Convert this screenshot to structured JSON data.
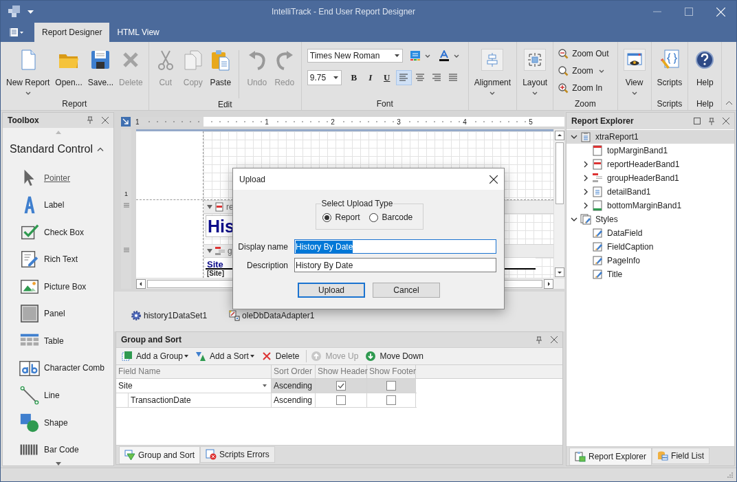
{
  "window": {
    "title": "IntelliTrack - End User Report Designer"
  },
  "ribbon_tabs": [
    {
      "label": "Report Designer",
      "selected": true
    },
    {
      "label": "HTML View",
      "selected": false
    }
  ],
  "ribbon_groups": [
    {
      "label": "Report",
      "kind": "large",
      "items": [
        {
          "label": "New Report",
          "kind": "new",
          "disabled": false,
          "dropdown": true
        },
        {
          "label": "Open...",
          "kind": "open",
          "disabled": false,
          "dropdown": false
        },
        {
          "label": "Save...",
          "kind": "save",
          "disabled": false,
          "dropdown": false
        },
        {
          "label": "Delete",
          "kind": "delete",
          "disabled": true,
          "dropdown": false
        }
      ]
    },
    {
      "label": "Edit",
      "kind": "large",
      "items": [
        {
          "label": "Cut",
          "kind": "cut",
          "disabled": true,
          "dropdown": false
        },
        {
          "label": "Copy",
          "kind": "copy",
          "disabled": true,
          "dropdown": false
        },
        {
          "label": "Paste",
          "kind": "paste",
          "disabled": false,
          "dropdown": false
        },
        {
          "label": "Undo",
          "kind": "undo",
          "disabled": true,
          "dropdown": false,
          "separated": true
        },
        {
          "label": "Redo",
          "kind": "redo",
          "disabled": true,
          "dropdown": false
        }
      ]
    },
    {
      "label": "Font",
      "kind": "font",
      "font_name": "Times New Roman",
      "font_size": "9.75",
      "format_buttons": [
        {
          "label": "B",
          "kind": "bold"
        },
        {
          "label": "I",
          "kind": "italic"
        },
        {
          "label": "U",
          "kind": "underline"
        }
      ],
      "align_buttons": [
        {
          "kind": "left",
          "selected": true
        },
        {
          "kind": "center",
          "selected": false
        },
        {
          "kind": "right",
          "selected": false
        },
        {
          "kind": "justify",
          "selected": false
        }
      ]
    },
    {
      "kind": "large",
      "items": [
        {
          "label": "Alignment",
          "kind": "alignment",
          "disabled": false,
          "dropdown": true
        }
      ]
    },
    {
      "kind": "large",
      "items": [
        {
          "label": "Layout",
          "kind": "layout",
          "disabled": false,
          "dropdown": true
        }
      ]
    },
    {
      "label": "Zoom",
      "kind": "small",
      "items": [
        {
          "label": "Zoom Out",
          "kind": "zoom-out",
          "dropdown": false
        },
        {
          "label": "Zoom",
          "kind": "zoom",
          "dropdown": true
        },
        {
          "label": "Zoom In",
          "kind": "zoom-in",
          "dropdown": false
        }
      ]
    },
    {
      "kind": "large",
      "items": [
        {
          "label": "View",
          "kind": "view",
          "disabled": false,
          "dropdown": true
        }
      ]
    },
    {
      "label": "Scripts",
      "kind": "large",
      "items": [
        {
          "label": "Scripts",
          "kind": "scripts",
          "disabled": false,
          "dropdown": false
        }
      ]
    },
    {
      "label": "Help",
      "kind": "large",
      "items": [
        {
          "label": "Help",
          "kind": "help",
          "disabled": false,
          "dropdown": false
        }
      ]
    }
  ],
  "toolbox": {
    "title": "Toolbox",
    "section": "Standard Control",
    "expanded": true,
    "items": [
      {
        "label": "Pointer",
        "kind": "pointer",
        "selected": true
      },
      {
        "label": "Label",
        "kind": "label",
        "selected": false
      },
      {
        "label": "Check Box",
        "kind": "checkbox",
        "selected": false
      },
      {
        "label": "Rich Text",
        "kind": "richtext",
        "selected": false
      },
      {
        "label": "Picture Box",
        "kind": "picture",
        "selected": false
      },
      {
        "label": "Panel",
        "kind": "panel",
        "selected": false
      },
      {
        "label": "Table",
        "kind": "table",
        "selected": false
      },
      {
        "label": "Character Comb",
        "kind": "comb",
        "selected": false
      },
      {
        "label": "Line",
        "kind": "line",
        "selected": false
      },
      {
        "label": "Shape",
        "kind": "shape",
        "selected": false
      },
      {
        "label": "Bar Code",
        "kind": "barcode",
        "selected": false
      }
    ]
  },
  "designer": {
    "ruler_labels": [
      "1",
      "1",
      "2",
      "3",
      "4",
      "5"
    ],
    "vertical_ruler_label": "1",
    "report_header_band": "re",
    "title_text": "His",
    "group_header_band": "g",
    "caption_text": "Site",
    "field_text": "[Site]"
  },
  "component_tray": [
    {
      "label": "history1DataSet1",
      "kind": "dataset"
    },
    {
      "label": "oleDbDataAdapter1",
      "kind": "adapter"
    }
  ],
  "group_and_sort": {
    "title": "Group and Sort",
    "toolbar": [
      {
        "label": "Add a Group",
        "kind": "add-group",
        "disabled": false,
        "dropdown": true
      },
      {
        "label": "Add a Sort",
        "kind": "add-sort",
        "disabled": false,
        "dropdown": true
      },
      {
        "label": "Delete",
        "kind": "delete",
        "disabled": false,
        "dropdown": false
      },
      {
        "label": "Move Up",
        "kind": "up",
        "disabled": true,
        "dropdown": false
      },
      {
        "label": "Move Down",
        "kind": "down",
        "disabled": false,
        "dropdown": false
      }
    ],
    "columns": [
      "Field Name",
      "Sort Order",
      "Show Header",
      "Show Footer"
    ],
    "rows": [
      {
        "field": "Site",
        "sort": "Ascending",
        "show_header": true,
        "show_footer": false,
        "selected": true,
        "children": [
          {
            "field": "TransactionDate",
            "sort": "Ascending",
            "show_header": false,
            "show_footer": false,
            "selected": false
          }
        ]
      }
    ],
    "tabs": [
      {
        "label": "Group and Sort",
        "kind": "group-sort",
        "selected": true
      },
      {
        "label": "Scripts Errors",
        "kind": "script-errors",
        "selected": false
      }
    ]
  },
  "report_explorer": {
    "title": "Report Explorer",
    "tree": [
      {
        "label": "xtraReport1",
        "kind": "report",
        "expanded": true,
        "selected": true,
        "children": [
          {
            "label": "topMarginBand1",
            "kind": "top-margin",
            "selected": false
          },
          {
            "label": "reportHeaderBand1",
            "kind": "report-header",
            "expanded": false,
            "selected": false
          },
          {
            "label": "groupHeaderBand1",
            "kind": "group-header",
            "expanded": false,
            "selected": false
          },
          {
            "label": "detailBand1",
            "kind": "detail",
            "expanded": false,
            "selected": false
          },
          {
            "label": "bottomMarginBand1",
            "kind": "bottom-margin",
            "expanded": false,
            "selected": false
          }
        ]
      },
      {
        "label": "Styles",
        "kind": "styles",
        "expanded": true,
        "selected": false,
        "children": [
          {
            "label": "DataField",
            "kind": "style",
            "selected": false
          },
          {
            "label": "FieldCaption",
            "kind": "style",
            "selected": false
          },
          {
            "label": "PageInfo",
            "kind": "style",
            "selected": false
          },
          {
            "label": "Title",
            "kind": "style",
            "selected": false
          }
        ]
      }
    ],
    "tabs": [
      {
        "label": "Report Explorer",
        "kind": "explorer",
        "selected": true
      },
      {
        "label": "Field List",
        "kind": "fields",
        "selected": false
      }
    ]
  },
  "dialog": {
    "title": "Upload",
    "group_label": "Select Upload Type",
    "options": [
      {
        "label": "Report",
        "selected": true
      },
      {
        "label": "Barcode",
        "selected": false
      }
    ],
    "fields": [
      {
        "label": "Display name",
        "value": "History By Date",
        "text_selected": true
      },
      {
        "label": "Description",
        "value": "History By Date",
        "text_selected": false
      }
    ],
    "buttons": [
      {
        "label": "Upload",
        "default": true
      },
      {
        "label": "Cancel",
        "default": false
      }
    ]
  }
}
